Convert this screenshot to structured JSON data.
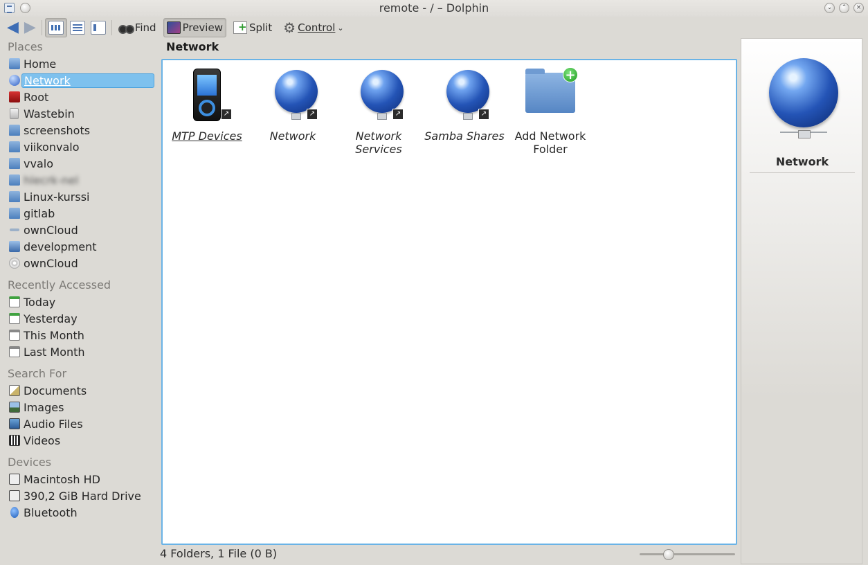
{
  "window": {
    "title": "remote - / – Dolphin"
  },
  "toolbar": {
    "find_label": "Find",
    "preview_label": "Preview",
    "split_label": "Split",
    "control_label": "Control"
  },
  "places": {
    "sections": [
      {
        "title": "Places",
        "items": [
          {
            "label": "Home",
            "icon": "home-icon"
          },
          {
            "label": "Network",
            "icon": "network-icon",
            "selected": true
          },
          {
            "label": "Root",
            "icon": "root-folder-icon"
          },
          {
            "label": "Wastebin",
            "icon": "wastebin-icon"
          },
          {
            "label": "screenshots",
            "icon": "folder-icon"
          },
          {
            "label": "viikonvalo",
            "icon": "folder-icon"
          },
          {
            "label": "vvalo",
            "icon": "folder-icon"
          },
          {
            "label": "hlecrk-nel",
            "icon": "folder-icon",
            "blurred": true
          },
          {
            "label": "Linux-kurssi",
            "icon": "folder-icon"
          },
          {
            "label": "gitlab",
            "icon": "folder-icon"
          },
          {
            "label": "ownCloud",
            "icon": "cloud-icon"
          },
          {
            "label": "development",
            "icon": "development-folder-icon"
          },
          {
            "label": "ownCloud",
            "icon": "optical-disc-icon"
          }
        ]
      },
      {
        "title": "Recently Accessed",
        "items": [
          {
            "label": "Today",
            "icon": "calendar-today-icon"
          },
          {
            "label": "Yesterday",
            "icon": "calendar-yesterday-icon"
          },
          {
            "label": "This Month",
            "icon": "calendar-month-icon"
          },
          {
            "label": "Last Month",
            "icon": "calendar-month-icon"
          }
        ]
      },
      {
        "title": "Search For",
        "items": [
          {
            "label": "Documents",
            "icon": "documents-icon"
          },
          {
            "label": "Images",
            "icon": "images-icon"
          },
          {
            "label": "Audio Files",
            "icon": "audio-files-icon"
          },
          {
            "label": "Videos",
            "icon": "videos-icon"
          }
        ]
      },
      {
        "title": "Devices",
        "items": [
          {
            "label": "Macintosh HD",
            "icon": "hard-drive-icon"
          },
          {
            "label": "390,2 GiB Hard Drive",
            "icon": "hard-drive-icon"
          },
          {
            "label": "Bluetooth",
            "icon": "bluetooth-icon"
          }
        ]
      }
    ]
  },
  "location": {
    "title": "Network"
  },
  "items": [
    {
      "label": "MTP Devices",
      "icon": "mtp-device-icon",
      "italic": true,
      "underline": true
    },
    {
      "label": "Network",
      "icon": "network-globe-icon",
      "italic": true
    },
    {
      "label": "Network Services",
      "icon": "network-globe-icon",
      "italic": true
    },
    {
      "label": "Samba Shares",
      "icon": "network-globe-icon",
      "italic": true
    },
    {
      "label": "Add Network Folder",
      "icon": "add-folder-icon",
      "italic": false
    }
  ],
  "info_panel": {
    "title": "Network",
    "icon": "network-globe-icon"
  },
  "status": {
    "text": "4 Folders, 1 File (0 B)"
  },
  "zoom": {
    "level_fraction": 0.3
  }
}
